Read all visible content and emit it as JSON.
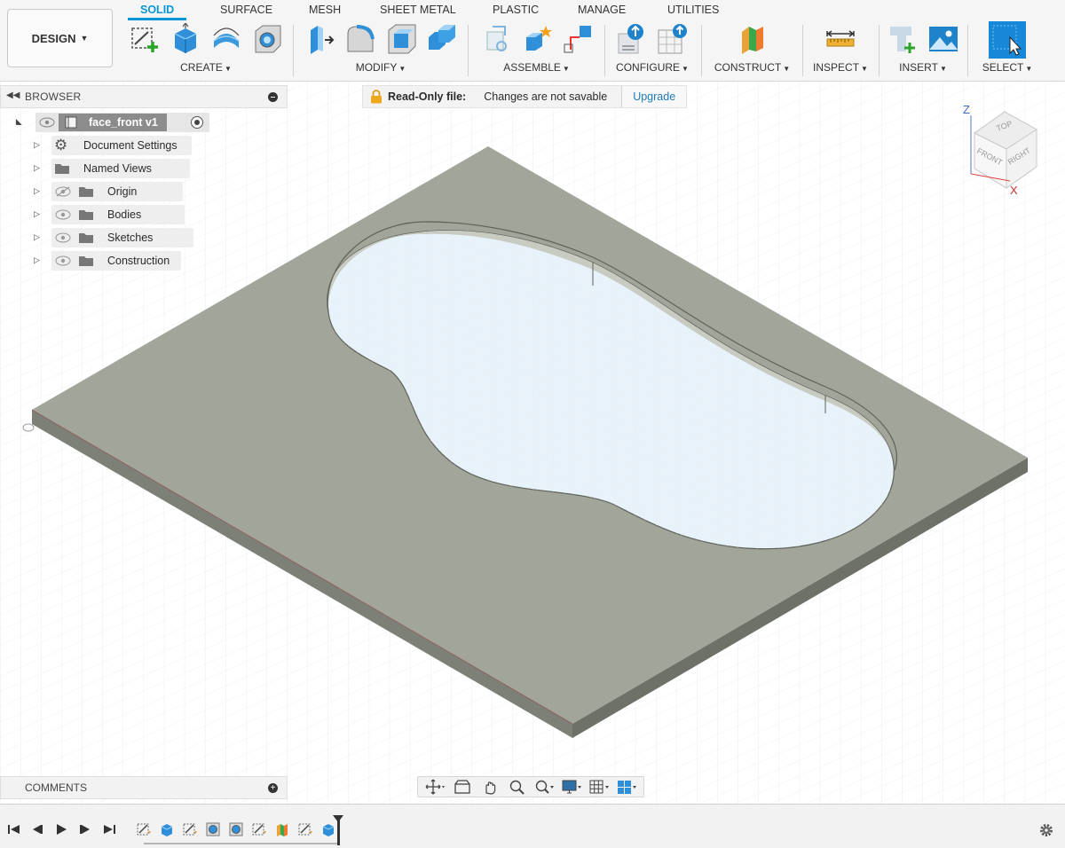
{
  "workspace": {
    "label": "DESIGN"
  },
  "tabs": [
    {
      "label": "SOLID",
      "active": true
    },
    {
      "label": "SURFACE"
    },
    {
      "label": "MESH"
    },
    {
      "label": "SHEET METAL"
    },
    {
      "label": "PLASTIC"
    },
    {
      "label": "MANAGE"
    },
    {
      "label": "UTILITIES"
    }
  ],
  "groups": {
    "create": "CREATE",
    "modify": "MODIFY",
    "assemble": "ASSEMBLE",
    "configure": "CONFIGURE",
    "construct": "CONSTRUCT",
    "inspect": "INSPECT",
    "insert": "INSERT",
    "select": "SELECT"
  },
  "browser": {
    "title": "BROWSER",
    "root": "face_front v1",
    "items": [
      {
        "label": "Document Settings",
        "icon": "gear-icon"
      },
      {
        "label": "Named Views",
        "icon": "folder-icon"
      },
      {
        "label": "Origin",
        "icon": "folder-icon",
        "hidden": true
      },
      {
        "label": "Bodies",
        "icon": "folder-icon"
      },
      {
        "label": "Sketches",
        "icon": "folder-icon"
      },
      {
        "label": "Construction",
        "icon": "folder-icon"
      }
    ]
  },
  "banner": {
    "title": "Read-Only file:",
    "message": "Changes are not savable",
    "action": "Upgrade"
  },
  "viewcube": {
    "top": "TOP",
    "front": "FRONT",
    "right": "RIGHT",
    "z": "Z",
    "x": "X"
  },
  "comments": {
    "title": "COMMENTS"
  },
  "colors": {
    "accent": "#0696d7",
    "body_top": "#a3a699",
    "body_side": "#868a7e",
    "pocket_floor": "#e6f1f8",
    "grid_line": "#e4e8ec"
  }
}
